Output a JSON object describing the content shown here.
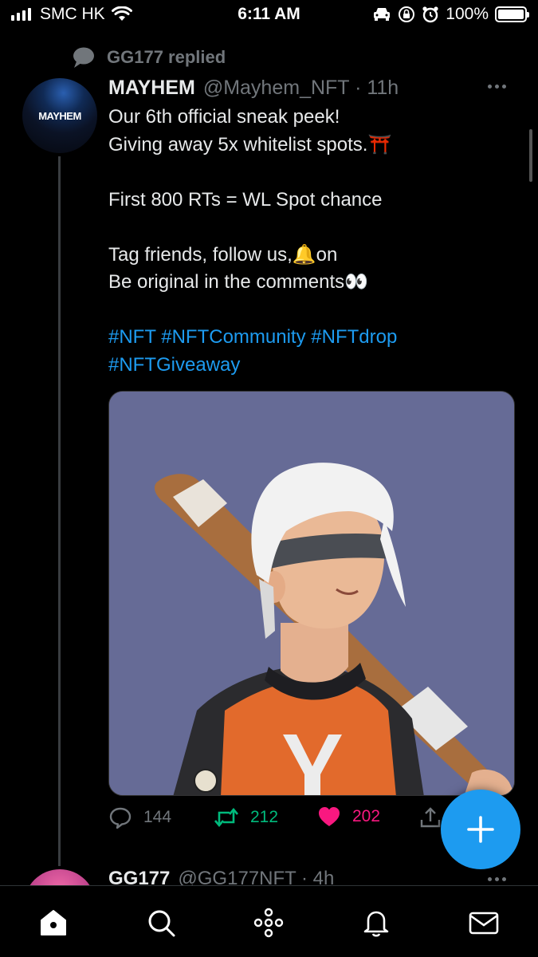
{
  "status_bar": {
    "carrier": "SMC HK",
    "time": "6:11 AM",
    "battery_percent": "100%",
    "battery_level": 1.0,
    "icons": [
      "signal-icon",
      "wifi-icon",
      "car-icon",
      "orientation-lock-icon",
      "alarm-icon",
      "battery-icon"
    ]
  },
  "context": {
    "replied_label": "GG177 replied",
    "icon": "speech-bubble-icon"
  },
  "tweet": {
    "avatar_text": "MAYHEM",
    "author_name": "MAYHEM",
    "handle_time": "@Mayhem_NFT · 11h",
    "lines": [
      "Our 6th official sneak peek!",
      "Giving away 5x whitelist spots.⛩️",
      "",
      "First 800 RTs = WL Spot chance",
      "",
      "Tag friends, follow us,🔔on",
      "Be original in the comments👀"
    ],
    "hashtags_line1": "#NFT #NFTCommunity #NFTdrop",
    "hashtags_line2": "#NFTGiveaway",
    "media_description_icon": "nft-character-image",
    "replies": "144",
    "retweets": "212",
    "likes": "202"
  },
  "next_tweet": {
    "author_name": "GG177",
    "handle_time": "@GG177NFT · 4h"
  },
  "fab": {
    "icon": "plus-icon"
  },
  "tab_bar": [
    "home-icon",
    "search-icon",
    "spaces-icon",
    "notifications-icon",
    "messages-icon"
  ],
  "colors": {
    "background": "#000000",
    "accent": "#1d9bf0",
    "retweet": "#00ba7c",
    "like": "#f91880",
    "muted": "#71767b",
    "media_bg": "#666b96"
  }
}
